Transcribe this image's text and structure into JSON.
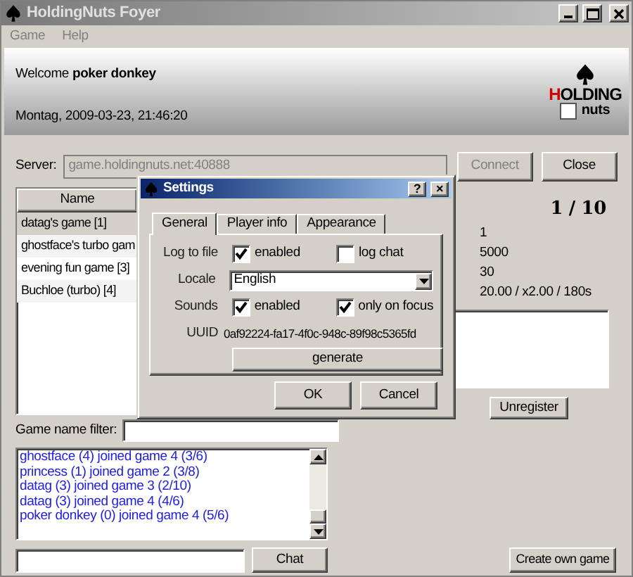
{
  "window": {
    "title": "HoldingNuts Foyer",
    "active": false
  },
  "menu": [
    "Game",
    "Help"
  ],
  "header": {
    "welcome": "Welcome **poker donkey**",
    "datetime": "Montag, 2009-03-23, 21:46:20",
    "logo": {
      "word": "HOLDING",
      "subword": "nuts"
    }
  },
  "server": {
    "label": "Server:",
    "value": "game.holdingnuts.net:40888",
    "disabled": true
  },
  "buttons_top": [
    {
      "label": "Connect",
      "disabled": true
    },
    {
      "label": "Close",
      "disabled": false
    }
  ],
  "games_table": {
    "columns": [
      "Name"
    ],
    "rows": [
      {
        "name": "datag's game [1]",
        "selected": true
      },
      {
        "name": "ghostface's turbo gam",
        "selected": false
      },
      {
        "name": "evening fun game [3]",
        "selected": false
      },
      {
        "name": "Buchloe (turbo) [4]",
        "selected": false
      }
    ]
  },
  "game_info": {
    "players": "1 / 10",
    "values": [
      "1",
      "5000",
      "30",
      "20.00 / x2.00 / 180s"
    ]
  },
  "unregister_button": "Unregister",
  "filter": {
    "label": "Game name filter:"
  },
  "log": [
    "ghostface (4) joined game 4 (3/6)",
    "princess (1) joined game 2 (3/8)",
    "datag (3) joined game 3 (2/10)",
    "datag (3) joined game 4 (4/6)",
    "poker donkey (0) joined game 4 (5/6)"
  ],
  "chat_button": "Chat",
  "create_button": "Create own game",
  "dialog": {
    "title": "Settings",
    "title_buttons": [
      "?",
      "×"
    ],
    "tabs": [
      {
        "label": "General",
        "selected": true
      },
      {
        "label": "Player info",
        "selected": false
      },
      {
        "label": "Appearance",
        "selected": false
      }
    ],
    "rows": [
      {
        "kind": "checks",
        "label": "Log to file",
        "checks": [
          {
            "label": "enabled",
            "checked": true
          },
          {
            "label": "log chat",
            "checked": false
          }
        ]
      },
      {
        "kind": "select",
        "label": "Locale",
        "value": "English"
      },
      {
        "kind": "checks",
        "label": "Sounds",
        "checks": [
          {
            "label": "enabled",
            "checked": true
          },
          {
            "label": "only on focus",
            "checked": true
          }
        ]
      },
      {
        "kind": "text",
        "label": "UUID",
        "value": "0af92224-fa17-4f0c-948c-89f98c5365fd"
      }
    ],
    "generate_button": "generate",
    "buttons": [
      "OK",
      "Cancel"
    ]
  }
}
